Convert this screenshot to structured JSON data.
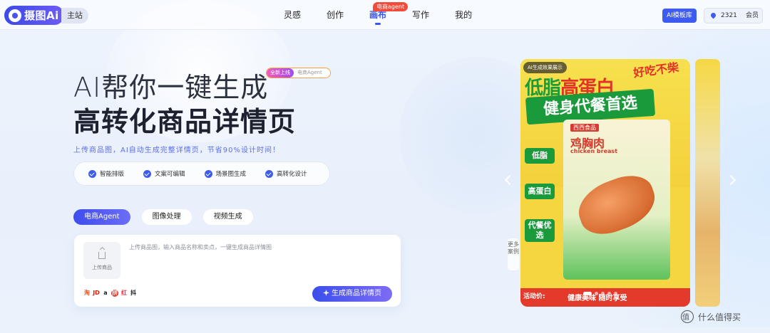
{
  "nav": {
    "logo_text": "摄图Ai",
    "main_site": "主站",
    "links": [
      {
        "label": "灵感"
      },
      {
        "label": "创作"
      },
      {
        "label": "画布"
      },
      {
        "label": "写作"
      },
      {
        "label": "我的"
      }
    ],
    "active_index": 2,
    "badge": "电商agent",
    "ai_template_lib": "AI模板库",
    "points": "2321",
    "member": "会员"
  },
  "hero": {
    "title_line1": "AI帮你一键生成",
    "title_line2": "高转化商品详情页",
    "tag_new": "全新上线",
    "tag_agent": "电商Agent",
    "subtitle": "上传商品图，AI自动生成完整详情页，节省90%设计时间！",
    "features": [
      "智能排版",
      "文案可编辑",
      "场景图生成",
      "高转化设计"
    ]
  },
  "tabs": [
    {
      "label": "电商Agent"
    },
    {
      "label": "图像处理"
    },
    {
      "label": "视频生成"
    }
  ],
  "input": {
    "upload_label": "上传商品",
    "placeholder": "上传商品图，输入商品名称和卖点，一键生成商品详情图",
    "platforms": [
      "淘",
      "JD",
      "a",
      "拼",
      "红",
      "抖"
    ],
    "generate_label": "生成商品详情页"
  },
  "showcase": {
    "badge": "AI生成效果展示",
    "headline_green": "低脂",
    "headline_red": "高蛋白",
    "headline_tag": "好吃不柴",
    "banner": "健身代餐首选",
    "brand": "西西食品",
    "product_cn": "鸡胸肉",
    "product_en": "chicken breast",
    "side_labels": [
      "低脂",
      "高蛋白",
      "代餐优选"
    ],
    "price_label": "活动价:",
    "slogan": "健康美味 随时享受",
    "more_cases": "更多案例"
  },
  "watermark": "什么值得买",
  "colors": {
    "accent": "#3d5bf0",
    "hot_badge": "#f24b3a",
    "product_green": "#1b9a3c",
    "product_red": "#e23227"
  }
}
